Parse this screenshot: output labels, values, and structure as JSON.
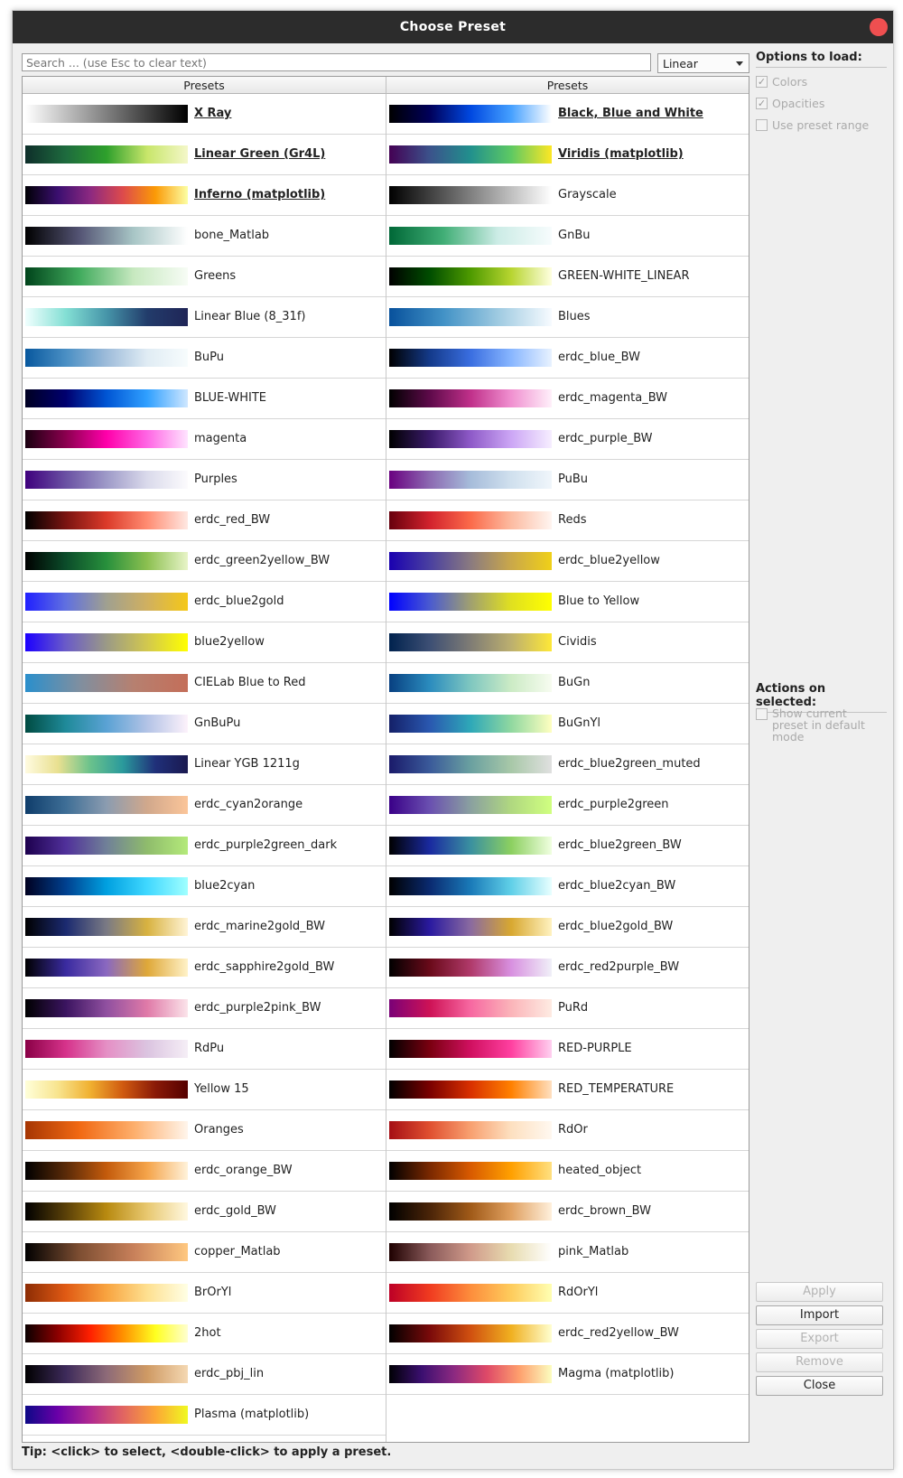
{
  "window": {
    "title": "Choose Preset"
  },
  "search": {
    "placeholder": "Search ... (use Esc to clear text)"
  },
  "mode": {
    "selected": "Linear"
  },
  "table": {
    "header_left": "Presets",
    "header_right": "Presets"
  },
  "presets_left": [
    {
      "name": "X Ray",
      "bold": true,
      "colors": [
        "#ffffff",
        "#000000"
      ]
    },
    {
      "name": "Linear Green (Gr4L)",
      "bold": true,
      "colors": [
        "#0e2e2a",
        "#1e6b3e",
        "#2ea02c",
        "#c8e66a",
        "#f4f7c9"
      ]
    },
    {
      "name": "Inferno (matplotlib)",
      "bold": true,
      "colors": [
        "#000004",
        "#3b0f70",
        "#8c2981",
        "#dd4a4c",
        "#fb9a06",
        "#fcffa4"
      ]
    },
    {
      "name": "bone_Matlab",
      "bold": false,
      "colors": [
        "#000000",
        "#545474",
        "#a8c6c6",
        "#ffffff"
      ]
    },
    {
      "name": "Greens",
      "bold": false,
      "colors": [
        "#00441b",
        "#41ab5d",
        "#c7e9c0",
        "#f7fcf5"
      ]
    },
    {
      "name": "Linear Blue (8_31f)",
      "bold": false,
      "colors": [
        "#f0fffe",
        "#83dfd4",
        "#4695a9",
        "#223c6b",
        "#202557"
      ]
    },
    {
      "name": "BuPu",
      "bold": false,
      "colors": [
        "#08589e",
        "#4a8fc4",
        "#9ebcda",
        "#e0ecf4",
        "#f7fcfd"
      ]
    },
    {
      "name": "BLUE-WHITE",
      "bold": false,
      "colors": [
        "#000022",
        "#00006f",
        "#0055d4",
        "#30a0ff",
        "#cfe7ff"
      ]
    },
    {
      "name": "magenta",
      "bold": false,
      "colors": [
        "#1a0010",
        "#8b004f",
        "#ff00aa",
        "#ff66e4",
        "#ffe4ff"
      ]
    },
    {
      "name": "Purples",
      "bold": false,
      "colors": [
        "#3f007d",
        "#6a51a3",
        "#9e9ac8",
        "#dadaeb",
        "#fcfbfd"
      ]
    },
    {
      "name": "erdc_red_BW",
      "bold": false,
      "colors": [
        "#000000",
        "#7a1411",
        "#db3a2a",
        "#ff8c72",
        "#ffe8e2"
      ]
    },
    {
      "name": "erdc_green2yellow_BW",
      "bold": false,
      "colors": [
        "#000000",
        "#0b4c2a",
        "#28903c",
        "#8cc050",
        "#e8f4c8"
      ]
    },
    {
      "name": "erdc_blue2gold",
      "bold": false,
      "colors": [
        "#2020ff",
        "#6070e0",
        "#a0a090",
        "#d0b060",
        "#f5c818"
      ]
    },
    {
      "name": "blue2yellow",
      "bold": false,
      "colors": [
        "#1c00ff",
        "#6a5bc8",
        "#9b9a86",
        "#d2c84e",
        "#ffff00"
      ]
    },
    {
      "name": "CIELab Blue to Red",
      "bold": false,
      "colors": [
        "#2a8fcc",
        "#7f8fa0",
        "#b68070",
        "#c46e59"
      ]
    },
    {
      "name": "GnBuPu",
      "bold": false,
      "colors": [
        "#004b41",
        "#1f8a9a",
        "#5aa2d4",
        "#b3c3e6",
        "#fdf2fb"
      ]
    },
    {
      "name": "Linear YGB 1211g",
      "bold": false,
      "colors": [
        "#fffbe0",
        "#e9e090",
        "#6ac28c",
        "#2a9a9c",
        "#20307a",
        "#1a1950"
      ]
    },
    {
      "name": "erdc_cyan2orange",
      "bold": false,
      "colors": [
        "#0f3d6b",
        "#3e6e96",
        "#8b9cb0",
        "#d1a88c",
        "#fbc599"
      ]
    },
    {
      "name": "erdc_purple2green_dark",
      "bold": false,
      "colors": [
        "#1d004e",
        "#50309a",
        "#708098",
        "#8fbc6c",
        "#b4ea7a"
      ]
    },
    {
      "name": "blue2cyan",
      "bold": false,
      "colors": [
        "#000020",
        "#00408f",
        "#00a0e0",
        "#40d8ff",
        "#a0ffff"
      ]
    },
    {
      "name": "erdc_marine2gold_BW",
      "bold": false,
      "colors": [
        "#000000",
        "#1b2a70",
        "#7a7a84",
        "#d8b240",
        "#fff4d6"
      ]
    },
    {
      "name": "erdc_sapphire2gold_BW",
      "bold": false,
      "colors": [
        "#000000",
        "#3a2ba0",
        "#8a68c0",
        "#dfa838",
        "#fff2c8"
      ]
    },
    {
      "name": "erdc_purple2pink_BW",
      "bold": false,
      "colors": [
        "#000000",
        "#3b1460",
        "#9050a0",
        "#e07aa8",
        "#fbe4ea"
      ]
    },
    {
      "name": "RdPu",
      "bold": false,
      "colors": [
        "#8a0046",
        "#d6338b",
        "#e58fc5",
        "#dbc4e0",
        "#f5eef6"
      ]
    },
    {
      "name": "Yellow 15",
      "bold": false,
      "colors": [
        "#ffffd9",
        "#f8e48e",
        "#f0b030",
        "#d05a10",
        "#8a1a08",
        "#550000"
      ]
    },
    {
      "name": "Oranges",
      "bold": false,
      "colors": [
        "#a63603",
        "#f16913",
        "#fdae6b",
        "#fff5eb"
      ]
    },
    {
      "name": "erdc_orange_BW",
      "bold": false,
      "colors": [
        "#000000",
        "#5a2a08",
        "#c45b0c",
        "#f5a44a",
        "#fff2da"
      ]
    },
    {
      "name": "erdc_gold_BW",
      "bold": false,
      "colors": [
        "#000000",
        "#5a4008",
        "#b88a10",
        "#e8c870",
        "#fff8e0"
      ]
    },
    {
      "name": "copper_Matlab",
      "bold": false,
      "colors": [
        "#000000",
        "#7d4e32",
        "#c8805a",
        "#ffc880"
      ]
    },
    {
      "name": "BrOrYl",
      "bold": false,
      "colors": [
        "#8c2c04",
        "#e05a14",
        "#f8a440",
        "#fee090",
        "#ffffe5"
      ]
    },
    {
      "name": "2hot",
      "bold": false,
      "colors": [
        "#0a0000",
        "#8c0000",
        "#ff2000",
        "#ff9000",
        "#ffff20",
        "#ffffd0"
      ]
    },
    {
      "name": "erdc_pbj_lin",
      "bold": false,
      "colors": [
        "#000000",
        "#3d2a5a",
        "#8d6a78",
        "#cf9a64",
        "#f4d8b2"
      ]
    },
    {
      "name": "Plasma (matplotlib)",
      "bold": false,
      "colors": [
        "#0d0887",
        "#6a00a8",
        "#b12a90",
        "#e16462",
        "#fca636",
        "#f0f921"
      ]
    }
  ],
  "presets_right": [
    {
      "name": "Black, Blue and White",
      "bold": true,
      "colors": [
        "#000000",
        "#00005a",
        "#0048e0",
        "#45a0ff",
        "#ffffff"
      ]
    },
    {
      "name": "Viridis (matplotlib)",
      "bold": true,
      "colors": [
        "#440154",
        "#3b528b",
        "#21908d",
        "#5dc963",
        "#fde725"
      ]
    },
    {
      "name": "Grayscale",
      "bold": false,
      "colors": [
        "#000000",
        "#ffffff"
      ]
    },
    {
      "name": "GnBu",
      "bold": false,
      "colors": [
        "#006837",
        "#41ae76",
        "#ccece6",
        "#f7fcfd"
      ]
    },
    {
      "name": "GREEN-WHITE_LINEAR",
      "bold": false,
      "colors": [
        "#000000",
        "#004d00",
        "#4e9a00",
        "#b7d530",
        "#ffffe0"
      ]
    },
    {
      "name": "Blues",
      "bold": false,
      "colors": [
        "#08519c",
        "#4292c6",
        "#9ecae1",
        "#f7fbff"
      ]
    },
    {
      "name": "erdc_blue_BW",
      "bold": false,
      "colors": [
        "#000000",
        "#143a8a",
        "#3a6ee0",
        "#88b6ff",
        "#e8f2ff"
      ]
    },
    {
      "name": "erdc_magenta_BW",
      "bold": false,
      "colors": [
        "#000000",
        "#5e0a4a",
        "#c0308a",
        "#f090d0",
        "#fff0fa"
      ]
    },
    {
      "name": "erdc_purple_BW",
      "bold": false,
      "colors": [
        "#000000",
        "#3a1a6a",
        "#8e5ac8",
        "#cca6f5",
        "#f6eeff"
      ]
    },
    {
      "name": "PuBu",
      "bold": false,
      "colors": [
        "#6a0080",
        "#8c6ab2",
        "#a6bcda",
        "#d0e0ee",
        "#f0f6fb"
      ]
    },
    {
      "name": "Reds",
      "bold": false,
      "colors": [
        "#67000d",
        "#d2222d",
        "#fb6a4a",
        "#fcbba1",
        "#fff5f0"
      ]
    },
    {
      "name": "erdc_blue2yellow",
      "bold": false,
      "colors": [
        "#1a00b0",
        "#4a40a0",
        "#8a7a80",
        "#caa84a",
        "#f0d018"
      ]
    },
    {
      "name": "Blue to Yellow",
      "bold": false,
      "colors": [
        "#0000ff",
        "#4a5ad0",
        "#a0a070",
        "#e0e020",
        "#ffff00"
      ]
    },
    {
      "name": "Cividis",
      "bold": false,
      "colors": [
        "#00224e",
        "#3d4f74",
        "#7f7c75",
        "#bcaf6f",
        "#fee838"
      ]
    },
    {
      "name": "BuGn",
      "bold": false,
      "colors": [
        "#084081",
        "#2b8cbe",
        "#7fc7c0",
        "#ccebc5",
        "#f7fcf0"
      ]
    },
    {
      "name": "BuGnYl",
      "bold": false,
      "colors": [
        "#142068",
        "#2a58b0",
        "#2ea8b8",
        "#90d8a0",
        "#ffffc0"
      ]
    },
    {
      "name": "erdc_blue2green_muted",
      "bold": false,
      "colors": [
        "#1a1a6a",
        "#3a5a9a",
        "#6aa0a0",
        "#a8c8a8",
        "#e0e0e0"
      ]
    },
    {
      "name": "erdc_purple2green",
      "bold": false,
      "colors": [
        "#3a0088",
        "#6a50b0",
        "#8aa0a0",
        "#b0d880",
        "#d0ff80"
      ]
    },
    {
      "name": "erdc_blue2green_BW",
      "bold": false,
      "colors": [
        "#000000",
        "#1a2aa0",
        "#3a90a0",
        "#8cd060",
        "#f0ffe0"
      ]
    },
    {
      "name": "erdc_blue2cyan_BW",
      "bold": false,
      "colors": [
        "#000000",
        "#0a2a70",
        "#1a7ab8",
        "#60d0e8",
        "#e8ffff"
      ]
    },
    {
      "name": "erdc_blue2gold_BW",
      "bold": false,
      "colors": [
        "#000000",
        "#2a1aa0",
        "#8a6aa0",
        "#d8a830",
        "#fff2c0"
      ]
    },
    {
      "name": "erdc_red2purple_BW",
      "bold": false,
      "colors": [
        "#000000",
        "#6a0a1a",
        "#b03a6a",
        "#d890e0",
        "#f0f0f8"
      ]
    },
    {
      "name": "PuRd",
      "bold": false,
      "colors": [
        "#7a0177",
        "#ce1256",
        "#f768a1",
        "#fbb4b9",
        "#feebe2"
      ]
    },
    {
      "name": "RED-PURPLE",
      "bold": false,
      "colors": [
        "#000000",
        "#7a0010",
        "#d01060",
        "#ff40a0",
        "#ffd0f0"
      ]
    },
    {
      "name": "RED_TEMPERATURE",
      "bold": false,
      "colors": [
        "#000000",
        "#7a0000",
        "#d83000",
        "#ff8000",
        "#ffe0c0"
      ]
    },
    {
      "name": "RdOr",
      "bold": false,
      "colors": [
        "#a50f15",
        "#e05030",
        "#f8a070",
        "#fde0c0",
        "#fff8f0"
      ]
    },
    {
      "name": "heated_object",
      "bold": false,
      "colors": [
        "#000000",
        "#7a2800",
        "#d85a00",
        "#ffa000",
        "#ffe080"
      ]
    },
    {
      "name": "erdc_brown_BW",
      "bold": false,
      "colors": [
        "#000000",
        "#4a2408",
        "#a05a18",
        "#e0a060",
        "#fff0dc"
      ]
    },
    {
      "name": "pink_Matlab",
      "bold": false,
      "colors": [
        "#1e0000",
        "#8a5a5a",
        "#d09a8a",
        "#e8dcb0",
        "#ffffff"
      ]
    },
    {
      "name": "RdOrYl",
      "bold": false,
      "colors": [
        "#bd0026",
        "#f03b20",
        "#fd8d3c",
        "#fecc5c",
        "#ffffb2"
      ]
    },
    {
      "name": "erdc_red2yellow_BW",
      "bold": false,
      "colors": [
        "#000000",
        "#7a0a0a",
        "#d05010",
        "#f0b020",
        "#ffffd0"
      ]
    },
    {
      "name": "Magma (matplotlib)",
      "bold": false,
      "colors": [
        "#000004",
        "#3b0f70",
        "#8c2981",
        "#de4968",
        "#fe9f6d",
        "#fcfdbf"
      ]
    }
  ],
  "tip": "Tip: <click> to select, <double-click> to apply a preset.",
  "options": {
    "heading": "Options to load:",
    "colors": "Colors",
    "opacities": "Opacities",
    "use_preset_range": "Use preset range"
  },
  "actions": {
    "heading": "Actions on selected:",
    "show_current": "Show current preset in default mode"
  },
  "buttons": {
    "apply": "Apply",
    "import": "Import",
    "export": "Export",
    "remove": "Remove",
    "close": "Close"
  }
}
